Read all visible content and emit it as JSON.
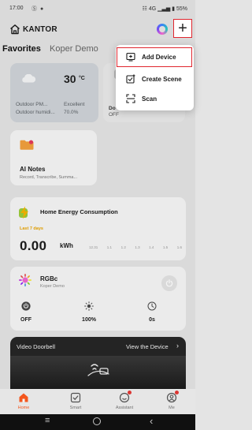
{
  "status_bar": {
    "time": "17:00",
    "left_icons": "Ⓢ ●",
    "right": "☷ 4G ▁▃▅ ▮ 55%"
  },
  "header": {
    "home_name": "KANTOR",
    "assistant_icon": "assistant-orb-icon",
    "add_icon": "plus-icon",
    "add_symbol": "+"
  },
  "tabs": [
    {
      "label": "Favorites"
    },
    {
      "label": "Koper Demo"
    }
  ],
  "weather": {
    "temperature": "30",
    "unit": "°C",
    "rows": [
      {
        "label": "Outdoor PM...",
        "value": "Excellent"
      },
      {
        "label": "Outdoor humidi...",
        "value": "70.0%"
      }
    ]
  },
  "device_card": {
    "name": "Do",
    "state": "OFF"
  },
  "ai_notes": {
    "title": "AI Notes",
    "subtitle": "Record, Transcribe, Summa..."
  },
  "energy": {
    "title": "Home Energy Consumption",
    "period": "Last 7 days",
    "value": "0.00",
    "unit": "kWh",
    "dates": [
      "12.31",
      "1.1",
      "1.2",
      "1.3",
      "1.4",
      "1.5",
      "1.6"
    ]
  },
  "rgb_device": {
    "name": "RGBc",
    "room": "Koper Demo",
    "controls": [
      {
        "icon": "power-icon",
        "label": "OFF"
      },
      {
        "icon": "brightness-icon",
        "label": "100%"
      },
      {
        "icon": "timer-icon",
        "label": "0s"
      }
    ]
  },
  "doorbell": {
    "title": "Video Doorbell",
    "view_label": "View the Device",
    "chevron": "›"
  },
  "bottom_nav": [
    {
      "label": "Home",
      "icon": "home-icon",
      "active": true
    },
    {
      "label": "Smart",
      "icon": "smart-icon",
      "active": false
    },
    {
      "label": "Assistant",
      "icon": "assistant-icon",
      "active": false
    },
    {
      "label": "Me",
      "icon": "me-icon",
      "active": false
    }
  ],
  "android_nav": {
    "recent": "≡",
    "back": "‹"
  },
  "menu": {
    "items": [
      {
        "label": "Add Device",
        "icon": "add-device-icon"
      },
      {
        "label": "Create Scene",
        "icon": "create-scene-icon"
      },
      {
        "label": "Scan",
        "icon": "scan-icon"
      }
    ]
  },
  "colors": {
    "accent": "#ff5a1f",
    "highlight": "#e0262e",
    "energy_period": "#e9a400"
  }
}
